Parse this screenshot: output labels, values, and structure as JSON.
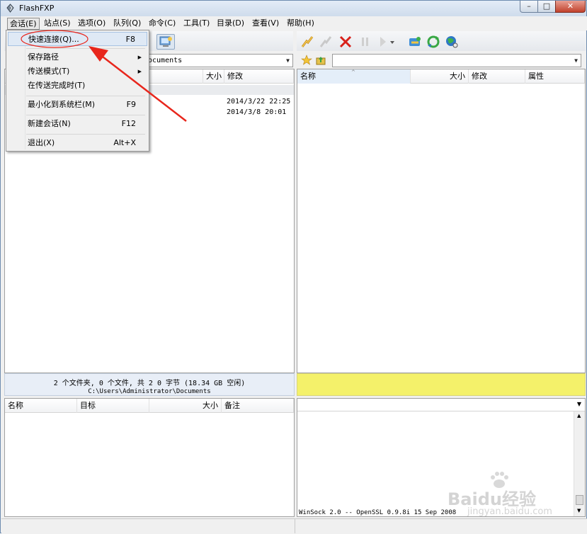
{
  "window": {
    "title": "FlashFXP"
  },
  "caption_buttons": {
    "minimize": "–",
    "maximize": "□",
    "close": "✕"
  },
  "menu": [
    "会话(E)",
    "站点(S)",
    "选项(O)",
    "队列(Q)",
    "命令(C)",
    "工具(T)",
    "目录(D)",
    "查看(V)",
    "帮助(H)"
  ],
  "session_menu": [
    {
      "label": "快速连接(Q)...",
      "shortcut": "F8"
    },
    {
      "label": "保存路径",
      "shortcut": "▶"
    },
    {
      "label": "传送模式(T)",
      "shortcut": "▶"
    },
    {
      "label": "在传送完成时(T)",
      "shortcut": ""
    },
    {
      "label": "最小化到系统栏(M)",
      "shortcut": "F9"
    },
    {
      "label": "新建会话(N)",
      "shortcut": "F12"
    },
    {
      "label": "退出(X)",
      "shortcut": "Alt+X"
    }
  ],
  "local": {
    "path": "ocuments",
    "columns": [
      "大小",
      "修改"
    ],
    "rows": [
      {
        "modified": "2014/3/22 22:25"
      },
      {
        "modified": "2014/3/8 20:01"
      }
    ],
    "status_line1": "2 个文件夹, 0 个文件, 共 2 0 字节 (18.34 GB 空闲)",
    "status_line2": "C:\\Users\\Administrator\\Documents"
  },
  "remote": {
    "path": "",
    "columns": [
      "名称",
      "大小",
      "修改",
      "属性"
    ]
  },
  "queue": {
    "columns": [
      "名称",
      "目标",
      "大小",
      "备注"
    ]
  },
  "log": {
    "line": "WinSock 2.0 -- OpenSSL 0.9.8i 15 Sep 2008"
  },
  "watermark": {
    "brand": "Baidu经验",
    "url": "jingyan.baidu.com"
  },
  "colors": {
    "status_yellow": "#f4f16a",
    "status_blue": "#e8eef7",
    "annotation_red": "#e8261c"
  }
}
